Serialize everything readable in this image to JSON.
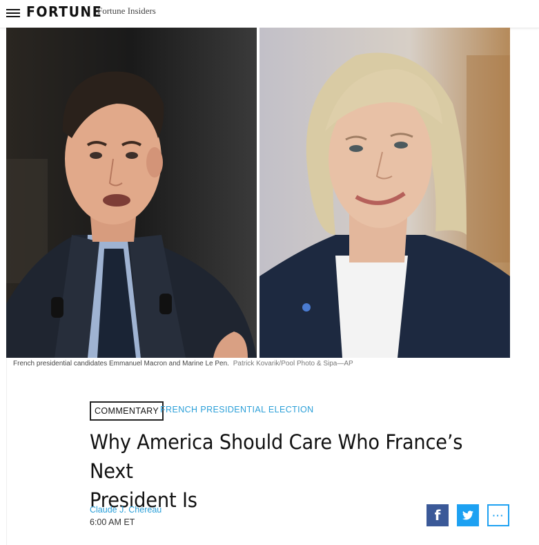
{
  "header": {
    "brand": "FORTUNE",
    "section": "Fortune Insiders"
  },
  "hero": {
    "caption": "French presidential candidates Emmanuel Macron and Marine Le Pen.",
    "credit": "Patrick Kovarik/Pool Photo & Sipa—AP"
  },
  "article": {
    "tag": "COMMENTARY",
    "topic": "FRENCH PRESIDENTIAL ELECTION",
    "headline_line1": "Why America Should Care Who France’s Next",
    "headline_line2": "President Is",
    "author": "Claude J. Chereau",
    "time": "6:00 AM ET"
  },
  "share": {
    "facebook_icon": "facebook-icon",
    "twitter_icon": "twitter-icon",
    "more_icon": "more-icon",
    "more_label": "···"
  },
  "colors": {
    "accent": "#2a9fd8",
    "facebook": "#3b5998",
    "twitter": "#1da1f2"
  }
}
